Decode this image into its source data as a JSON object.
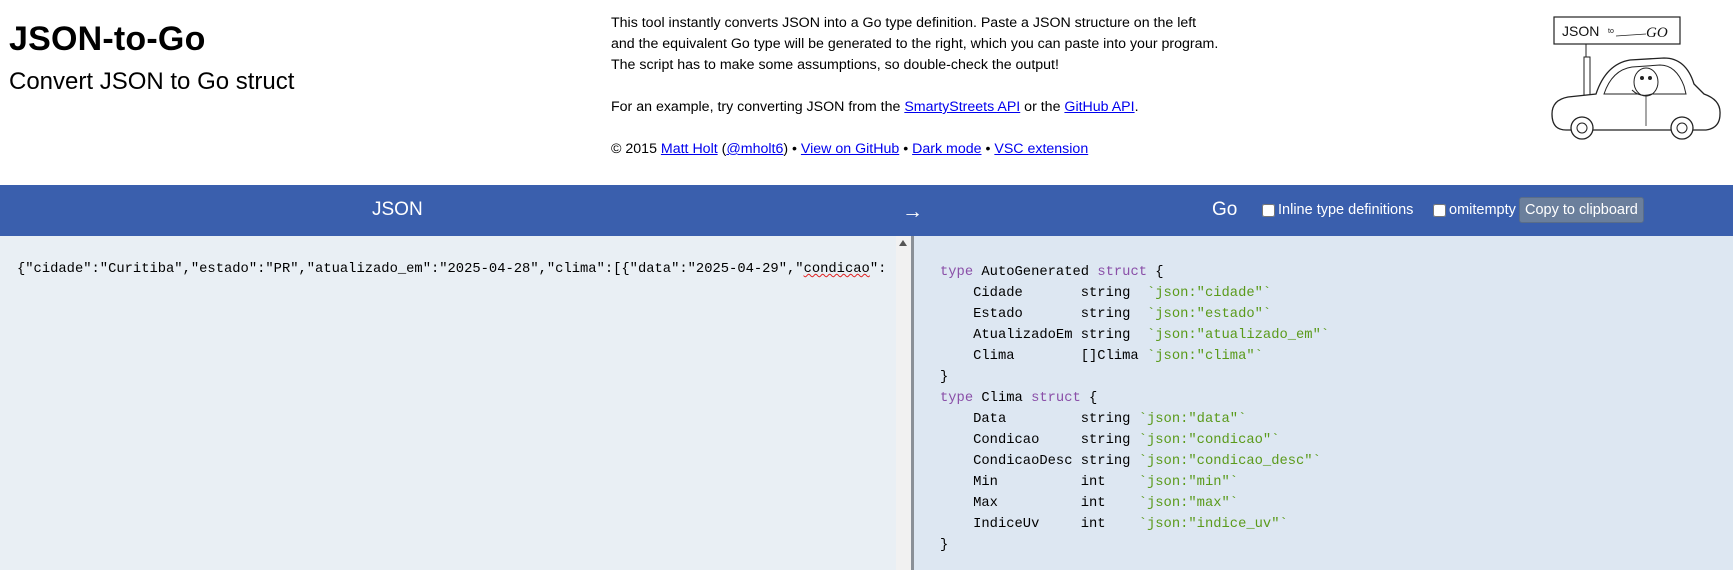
{
  "header": {
    "title": "JSON-to-Go",
    "subtitle": "Convert JSON to Go struct",
    "intro_line1": "This tool instantly converts JSON into a Go type definition. Paste a JSON structure on the left",
    "intro_line2": "and the equivalent Go type will be generated to the right, which you can paste into your program.",
    "intro_line3": "The script has to make some assumptions, so double-check the output!",
    "example_prefix": "For an example, try converting JSON from the ",
    "example_link1": "SmartyStreets API",
    "example_mid": " or the ",
    "example_link2": "GitHub API",
    "example_suffix": ".",
    "copyright_prefix": "© 2015 ",
    "author": "Matt Holt",
    "open_paren": " (",
    "handle": "@mholt6",
    "close_paren": ") • ",
    "github_link": "View on GitHub",
    "sep1": " • ",
    "dark_mode_link": "Dark mode",
    "sep2": " • ",
    "vsc_link": "VSC extension",
    "logo_text": "JSON",
    "logo_to": "to",
    "logo_go": "GO"
  },
  "bar": {
    "json_label": "JSON",
    "arrow": "→",
    "go_label": "Go",
    "inline_label": "Inline type definitions",
    "omitempty_label": "omitempty",
    "copy_label": "Copy to clipboard",
    "inline_checked": false,
    "omitempty_checked": false
  },
  "json_pane": {
    "text_before": "{\"cidade\":\"Curitiba\",\"estado\":\"PR\",\"atualizado_em\":\"2025-04-28\",\"clima\":[{\"data\":\"2025-04-29\",\"",
    "text_flagged": "condicao",
    "text_after": "\":"
  },
  "go_pane": {
    "lines": [
      [
        {
          "t": "type",
          "c": "kw"
        },
        {
          "t": " AutoGenerated "
        },
        {
          "t": "struct",
          "c": "kw"
        },
        {
          "t": " {"
        }
      ],
      [
        {
          "t": "    Cidade       string  "
        },
        {
          "t": "`json:\"cidade\"`",
          "c": "tag"
        }
      ],
      [
        {
          "t": "    Estado       string  "
        },
        {
          "t": "`json:\"estado\"`",
          "c": "tag"
        }
      ],
      [
        {
          "t": "    AtualizadoEm string  "
        },
        {
          "t": "`json:\"atualizado_em\"`",
          "c": "tag"
        }
      ],
      [
        {
          "t": "    Clima        []Clima "
        },
        {
          "t": "`json:\"clima\"`",
          "c": "tag"
        }
      ],
      [
        {
          "t": "}"
        }
      ],
      [
        {
          "t": "type",
          "c": "kw"
        },
        {
          "t": " Clima "
        },
        {
          "t": "struct",
          "c": "kw"
        },
        {
          "t": " {"
        }
      ],
      [
        {
          "t": "    Data         string "
        },
        {
          "t": "`json:\"data\"`",
          "c": "tag"
        }
      ],
      [
        {
          "t": "    Condicao     string "
        },
        {
          "t": "`json:\"condicao\"`",
          "c": "tag"
        }
      ],
      [
        {
          "t": "    CondicaoDesc string "
        },
        {
          "t": "`json:\"condicao_desc\"`",
          "c": "tag"
        }
      ],
      [
        {
          "t": "    Min          int    "
        },
        {
          "t": "`json:\"min\"`",
          "c": "tag"
        }
      ],
      [
        {
          "t": "    Max          int    "
        },
        {
          "t": "`json:\"max\"`",
          "c": "tag"
        }
      ],
      [
        {
          "t": "    IndiceUv     int    "
        },
        {
          "t": "`json:\"indice_uv\"`",
          "c": "tag"
        }
      ],
      [
        {
          "t": "}"
        }
      ]
    ]
  },
  "colors": {
    "bar": "#3a5fad",
    "json_pane_bg": "#e9eff4",
    "go_pane_bg": "#dde7f2",
    "keyword": "#8a4fa8",
    "tag": "#5a9a1a"
  },
  "icons": {
    "logo": "gopher-car-logo",
    "scroll_up": "scroll-up-arrow-icon"
  }
}
